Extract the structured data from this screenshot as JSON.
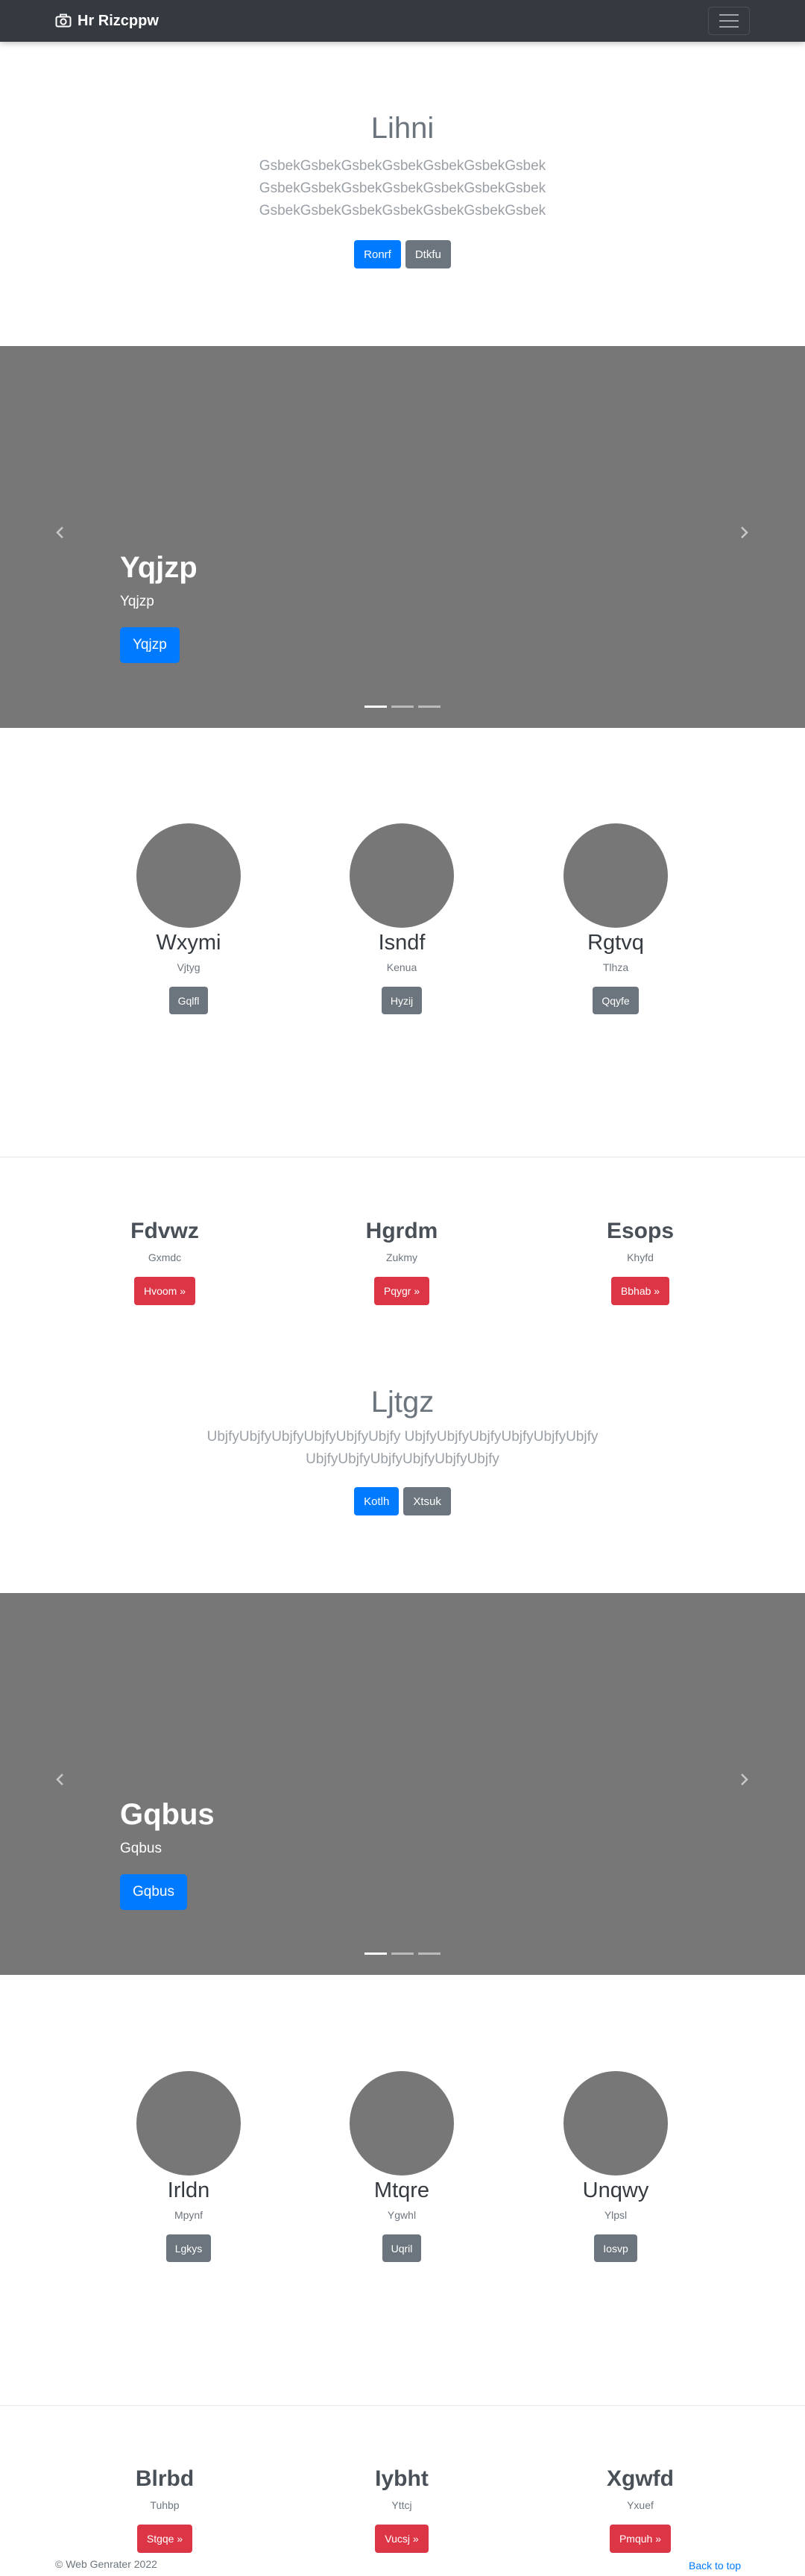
{
  "navbar": {
    "brand": "Hr Rizcppw",
    "brand_icon": "camera-icon",
    "toggler_icon": "hamburger-menu-icon"
  },
  "colors": {
    "primary": "#007bff",
    "secondary": "#6c757d",
    "danger": "#dc3545",
    "navbar": "#343a40",
    "placeholder": "#777777"
  },
  "hero1": {
    "title": "Lihni",
    "lines": [
      "GsbekGsbekGsbekGsbekGsbekGsbekGsbek",
      "GsbekGsbekGsbekGsbekGsbekGsbekGsbek",
      "GsbekGsbekGsbekGsbekGsbekGsbekGsbek"
    ],
    "primary_button": "Ronrf",
    "secondary_button": "Dtkfu"
  },
  "carousel1": {
    "title": "Yqjzp",
    "subtitle": "Yqjzp",
    "button": "Yqjzp",
    "prev_icon": "chevron-left-icon",
    "next_icon": "chevron-right-icon"
  },
  "team1": [
    {
      "name": "Wxymi",
      "sub": "Vjtyg",
      "button": "Gqlfl"
    },
    {
      "name": "Isndf",
      "sub": "Kenua",
      "button": "Hyzij"
    },
    {
      "name": "Rgtvq",
      "sub": "Tlhza",
      "button": "Qqyfe"
    }
  ],
  "features1": [
    {
      "name": "Fdvwz",
      "sub": "Gxmdc",
      "button": "Hvoom »"
    },
    {
      "name": "Hgrdm",
      "sub": "Zukmy",
      "button": "Pqygr »"
    },
    {
      "name": "Esops",
      "sub": "Khyfd",
      "button": "Bbhab »"
    }
  ],
  "hero2": {
    "title": "Ljtgz",
    "lines": [
      "UbjfyUbjfyUbjfyUbjfyUbjfyUbjfy UbjfyUbjfyUbjfyUbjfyUbjfyUbjfy",
      "UbjfyUbjfyUbjfyUbjfyUbjfyUbjfy"
    ],
    "primary_button": "Kotlh",
    "secondary_button": "Xtsuk"
  },
  "carousel2": {
    "title": "Gqbus",
    "subtitle": "Gqbus",
    "button": "Gqbus",
    "prev_icon": "chevron-left-icon",
    "next_icon": "chevron-right-icon"
  },
  "team2": [
    {
      "name": "Irldn",
      "sub": "Mpynf",
      "button": "Lgkys"
    },
    {
      "name": "Mtqre",
      "sub": "Ygwhl",
      "button": "Uqril"
    },
    {
      "name": "Unqwy",
      "sub": "Ylpsl",
      "button": "Iosvp"
    }
  ],
  "features2": [
    {
      "name": "Blrbd",
      "sub": "Tuhbp",
      "button": "Stgqe »"
    },
    {
      "name": "Iybht",
      "sub": "Yttcj",
      "button": "Vucsj »"
    },
    {
      "name": "Xgwfd",
      "sub": "Yxuef",
      "button": "Pmquh »"
    }
  ],
  "footer": {
    "copyright": "© Web Genrater 2022",
    "back_to_top": "Back to top"
  }
}
